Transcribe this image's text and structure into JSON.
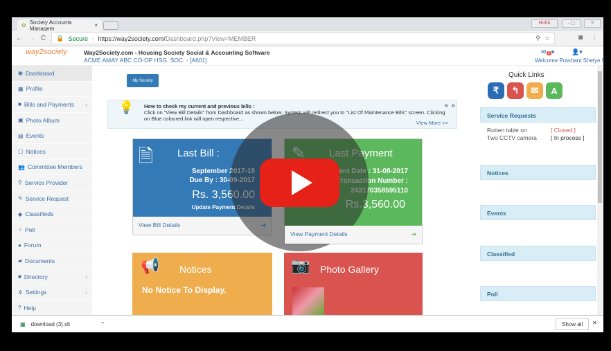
{
  "browser": {
    "tab_title": "Society Accounts Managem",
    "tab_close": "×",
    "secure_label": "Secure",
    "url_host": "https://way2society.com/",
    "url_path": "Dashboard.php?View=MEMBER",
    "window_user": "Rohit"
  },
  "header": {
    "logo": "way2society",
    "title": "Way2Society.com - Housing Society Social & Accounting Software",
    "society": "ACME AMAY ABC CO-OP HSG. SOC. - [A601]",
    "notification_count": "2",
    "welcome": "Welcome Prashant Shetye !"
  },
  "sidebar": {
    "items": [
      {
        "label": "Dashboard",
        "icon": "dashboard-icon",
        "glyph": "◉"
      },
      {
        "label": "Profile",
        "icon": "profile-icon",
        "glyph": "▦"
      },
      {
        "label": "Bills and Payments",
        "icon": "folder-icon",
        "glyph": "■",
        "chevron": "‹"
      },
      {
        "label": "Photo Album",
        "icon": "photo-icon",
        "glyph": "▣"
      },
      {
        "label": "Events",
        "icon": "calendar-icon",
        "glyph": "▤"
      },
      {
        "label": "Notices",
        "icon": "notice-icon",
        "glyph": "▢"
      },
      {
        "label": "Committee Members",
        "icon": "users-icon",
        "glyph": "👥"
      },
      {
        "label": "Service Provider",
        "icon": "search-icon",
        "glyph": "⚲"
      },
      {
        "label": "Service Request",
        "icon": "edit-icon",
        "glyph": "✎"
      },
      {
        "label": "Classifieds",
        "icon": "tags-icon",
        "glyph": "◆"
      },
      {
        "label": "Poll",
        "icon": "bulb-icon",
        "glyph": "♁"
      },
      {
        "label": "Forum",
        "icon": "comments-icon",
        "glyph": "●"
      },
      {
        "label": "Documents",
        "icon": "book-icon",
        "glyph": "▰"
      },
      {
        "label": "Directory",
        "icon": "folder-icon",
        "glyph": "■",
        "chevron": "‹"
      },
      {
        "label": "Settings",
        "icon": "gear-icon",
        "glyph": "✲",
        "chevron": "‹"
      },
      {
        "label": "Help",
        "icon": "help-icon",
        "glyph": "?"
      }
    ]
  },
  "main": {
    "my_society": "My Society",
    "tip": {
      "title": "How to check my current and previous bills  :",
      "body": "Click on \"View Bill Details\" from Dashboard as shown below.   System will redirect you to  \"List Of Maintenance Bills\" screen. Clicking on Blue coloured link will open respective...",
      "view_more": "View More >>",
      "prev": "«",
      "next": "»"
    },
    "last_bill": {
      "title": "Last Bill :",
      "period": "September 2017-18",
      "due": "Due By : 30-09-2017",
      "amount": "Rs. 3,560.00",
      "update": "Update Payment Details",
      "footer": "View Bill Details"
    },
    "last_payment": {
      "title": "Last Payment",
      "date": "Payment Date : 31-08-2017",
      "txn_label": "Transaction Number :",
      "txn": "243170358595110",
      "amount": "Rs.3,560.00",
      "footer": "View Payment Details"
    },
    "notices": {
      "title": "Notices",
      "body": "No Notice To Display."
    },
    "gallery": {
      "title": "Photo Gallery"
    }
  },
  "right": {
    "quick_links": "Quick Links",
    "quick": [
      {
        "glyph": "₹",
        "color": "#2a6db5"
      },
      {
        "glyph": "↰",
        "color": "#d9534f"
      },
      {
        "glyph": "✉",
        "color": "#f0ad4e"
      },
      {
        "glyph": "A",
        "color": "#5cb85c"
      }
    ],
    "service_requests": "Service Requests",
    "requests": [
      {
        "name": "Rotten table on",
        "status": "[ Closed ]"
      },
      {
        "name": "Two CCTV camera",
        "status": "[ In process ]"
      }
    ],
    "panels": [
      "Notices",
      "Events",
      "Classified",
      "Poll"
    ]
  },
  "download": {
    "file": "download (3).xlt",
    "show_all": "Show all"
  },
  "colors": {
    "blue": "#337ab7",
    "green": "#5cb85c",
    "orange": "#f0ad4e",
    "red": "#d9534f",
    "play": "#e62117"
  }
}
